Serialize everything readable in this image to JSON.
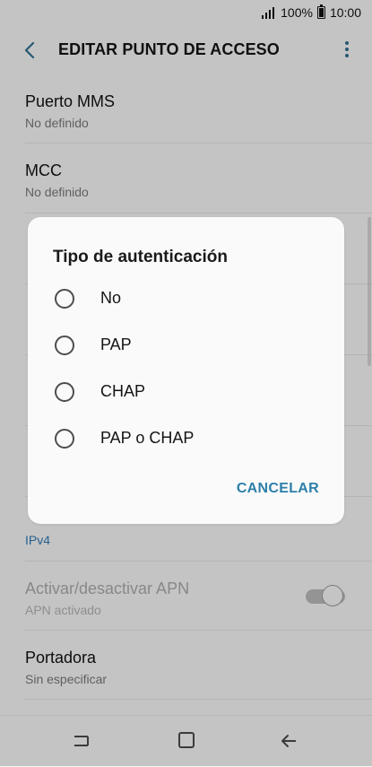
{
  "status": {
    "battery": "100%",
    "time": "10:00"
  },
  "appbar": {
    "title": "EDITAR PUNTO DE ACCESO",
    "back_icon": "chevron-left-icon",
    "more_icon": "more-vert-icon"
  },
  "list": [
    {
      "title": "Puerto MMS",
      "subtitle": "No definido"
    },
    {
      "title": "MCC",
      "subtitle": "No definido"
    },
    {
      "title": "",
      "subtitle": "IPv4"
    },
    {
      "title": "Activar/desactivar APN",
      "subtitle": "APN activado"
    },
    {
      "title": "Portadora",
      "subtitle": "Sin especificar"
    }
  ],
  "dialog": {
    "title": "Tipo de autenticación",
    "options": [
      "No",
      "PAP",
      "CHAP",
      "PAP o CHAP"
    ],
    "cancel": "CANCELAR"
  },
  "colors": {
    "accent": "#2d7fa9",
    "link_blue": "#2f79b5",
    "background": "#f6f6f6",
    "dialog_bg": "#fafafa"
  },
  "navbar": {
    "icons": [
      "recent-apps-icon",
      "home-icon",
      "back-arrow-icon"
    ]
  }
}
